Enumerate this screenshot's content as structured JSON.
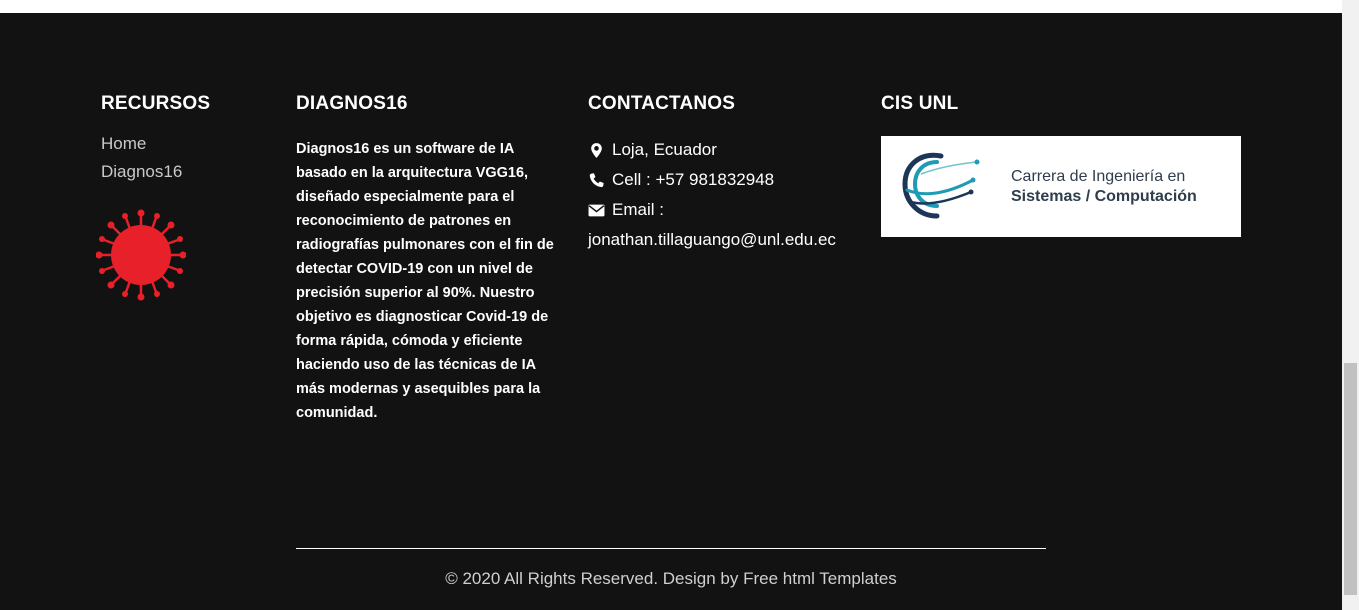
{
  "resources": {
    "title": "RECURSOS",
    "links": [
      {
        "label": "Home"
      },
      {
        "label": "Diagnos16"
      }
    ],
    "icon": "coronavirus-icon"
  },
  "about": {
    "title": "DIAGNOS16",
    "description": "Diagnos16 es un software de IA basado en la arquitectura VGG16, diseñado especialmente para el reconocimiento de patrones en radiografías pulmonares con el fin de detectar COVID-19 con un nivel de precisión superior al 90%. Nuestro objetivo es diagnosticar Covid-19 de forma rápida, cómoda y eficiente haciendo uso de las técnicas de IA más modernas y asequibles para la comunidad."
  },
  "contact": {
    "title": "CONTACTANOS",
    "location": "Loja, Ecuador",
    "cell": "Cell : +57 981832948",
    "email_label": "Email :",
    "email": "jonathan.tillaguango@unl.edu.ec",
    "icons": [
      "map-marker-icon",
      "phone-icon",
      "envelope-icon"
    ]
  },
  "partner": {
    "title": "CIS UNL",
    "logo_line1": "Carrera de Ingeniería en",
    "logo_line2": "Sistemas / Computación"
  },
  "footer": {
    "copyright": "© 2020 All Rights Reserved. Design by Free html Templates"
  },
  "colors": {
    "background": "#121212",
    "virus": "#e8202a",
    "logo_teal": "#1e9bb5",
    "logo_navy": "#1d3557"
  }
}
